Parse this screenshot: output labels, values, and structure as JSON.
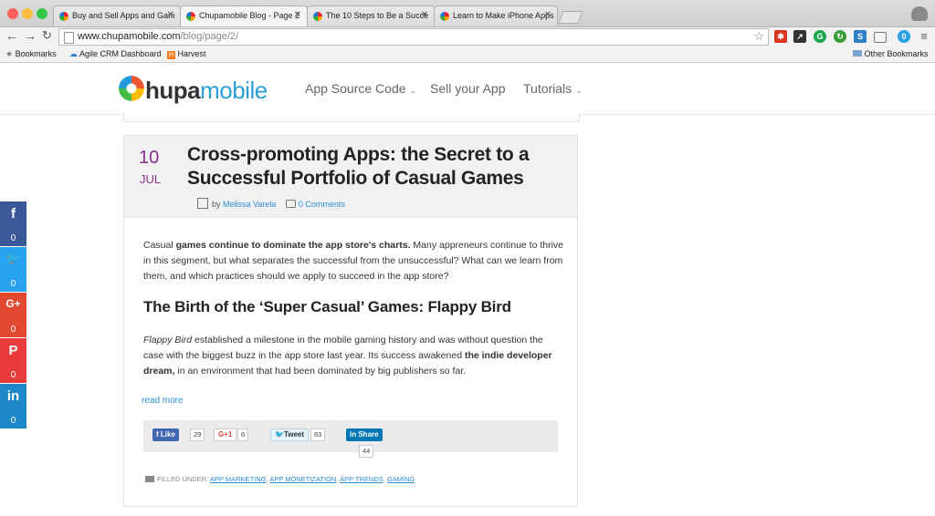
{
  "browser": {
    "tabs": [
      {
        "title": "Buy and Sell Apps and Gam",
        "active": false
      },
      {
        "title": "Chupamobile Blog - Page 2",
        "active": true
      },
      {
        "title": "The 10 Steps to Be a Succe",
        "active": false
      },
      {
        "title": "Learn to Make iPhone Apps",
        "active": false
      }
    ],
    "address": {
      "domain": "www.chupamobile.com",
      "path": "/blog/page/2/"
    },
    "extension_badge": "0",
    "bookmarks": [
      "Bookmarks",
      "Agile CRM Dashboard",
      "Harvest"
    ],
    "other_bookmarks": "Other Bookmarks"
  },
  "site": {
    "logo": {
      "part1": "hupa",
      "part2": "mobile"
    },
    "nav": [
      "App Source Code",
      "Sell your App",
      "Tutorials"
    ]
  },
  "post": {
    "day": "10",
    "month": "JUL",
    "title": "Cross-promoting Apps: the Secret to a Successful Portfolio of Casual Games",
    "by": "by",
    "author": "Melissa Varela",
    "comments": "0 Comments",
    "para1": {
      "pre": "Casual ",
      "bold": "games continue to dominate the app store's charts.",
      "post": " Many appreneurs continue to thrive in this segment, but what separates the successful from the unsuccessful? What can we learn from them, and which practices should we apply to succeed in the app store?"
    },
    "subheading": "The Birth of the ‘Super Casual’ Games: Flappy Bird",
    "para2": {
      "italic": "Flappy Bird",
      "mid": " established a milestone in the mobile gaming history and was without question the case with the biggest buzz in the app store last year. Its success awakened ",
      "bold": "the indie developer dream,",
      "post": " in an environment that had been dominated by big publishers so far."
    },
    "read_more": "read more",
    "share": {
      "like": {
        "label": "Like",
        "count": "29"
      },
      "gplus": {
        "label": "+1",
        "count": "6"
      },
      "tweet": {
        "label": "Tweet",
        "count": "83"
      },
      "linkedin": {
        "label": "Share",
        "count": "44"
      }
    },
    "filed_under_label": "FILLED UNDER:",
    "tags": [
      "APP MARKETING",
      "APP MONETIZATION",
      "APP TRENDS",
      "GAMING"
    ]
  },
  "social_sidebar": [
    {
      "network": "facebook",
      "glyph": "f",
      "count": "0",
      "color": "#3b5998"
    },
    {
      "network": "twitter",
      "glyph": "🐦",
      "count": "0",
      "color": "#2aa3ef"
    },
    {
      "network": "google-plus",
      "glyph": "G+",
      "count": "0",
      "color": "#e2472f"
    },
    {
      "network": "pinterest",
      "glyph": "P",
      "count": "0",
      "color": "#e93b3b"
    },
    {
      "network": "linkedin",
      "glyph": "in",
      "count": "0",
      "color": "#1c87c9"
    }
  ]
}
